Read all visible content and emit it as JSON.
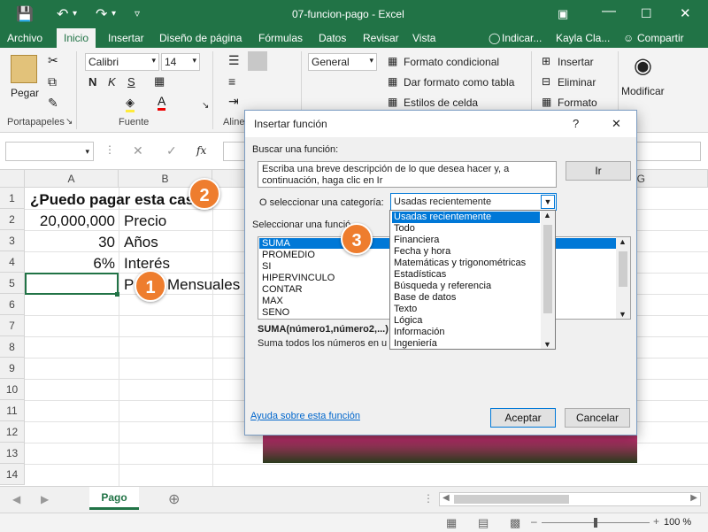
{
  "window": {
    "title": "07-funcion-pago  -  Excel"
  },
  "ribbon_tabs": [
    "Archivo",
    "Inicio",
    "Insertar",
    "Diseño de página",
    "Fórmulas",
    "Datos",
    "Revisar",
    "Vista"
  ],
  "tell_me": "Indicar...",
  "user": "Kayla Cla...",
  "share": "Compartir",
  "ribbon": {
    "paste": "Pegar",
    "font_name": "Calibri",
    "font_size": "14",
    "number_format": "General",
    "bold": "N",
    "italic": "K",
    "underline": "S",
    "cond_format": "Formato condicional",
    "table_format": "Dar formato como tabla",
    "cell_styles": "Estilos de celda",
    "insert": "Insertar",
    "delete": "Eliminar",
    "format": "Formato",
    "modify": "Modificar",
    "group_clipboard": "Portapapeles",
    "group_font": "Fuente",
    "group_align": "Aline"
  },
  "formula_bar": {
    "name_box": "",
    "fx": "fx"
  },
  "columns": [
    "A",
    "B",
    "G"
  ],
  "rows": [
    "1",
    "2",
    "3",
    "4",
    "5",
    "6",
    "7",
    "8",
    "9",
    "10",
    "11",
    "12",
    "13",
    "14"
  ],
  "cells": {
    "A1": "¿Puedo pagar esta casa",
    "A2": "20,000,000",
    "B2": "Precio",
    "A3": "30",
    "B3": "Años",
    "A4": "6%",
    "B4": "Interés",
    "B5_part": "P",
    "B5_rest": "Mensuales"
  },
  "callouts": [
    "1",
    "2",
    "3"
  ],
  "dialog": {
    "title": "Insertar función",
    "help_btn": "?",
    "close_btn": "✕",
    "search_label": "Buscar una función:",
    "search_text": "Escriba una breve descripción de lo que desea hacer y, a continuación, haga clic en Ir",
    "go_button": "Ir",
    "category_label": "O seleccionar una categoría:",
    "category_value": "Usadas recientemente",
    "select_label": "Seleccionar una funció",
    "functions": [
      "SUMA",
      "PROMEDIO",
      "SI",
      "HIPERVINCULO",
      "CONTAR",
      "MAX",
      "SENO"
    ],
    "signature": "SUMA(número1,número2,...)",
    "description": "Suma todos los números en u",
    "help_link": "Ayuda sobre esta función",
    "ok": "Aceptar",
    "cancel": "Cancelar"
  },
  "category_options": [
    "Usadas recientemente",
    "Todo",
    "Financiera",
    "Fecha y hora",
    "Matemáticas y trigonométricas",
    "Estadísticas",
    "Búsqueda y referencia",
    "Base de datos",
    "Texto",
    "Lógica",
    "Información",
    "Ingeniería"
  ],
  "sheet_tabs": [
    "Pago"
  ],
  "status": {
    "zoom": "100 %"
  },
  "colors": {
    "excel_green": "#217346",
    "accent_blue": "#0078d7",
    "callout_orange": "#ee7d2e"
  }
}
